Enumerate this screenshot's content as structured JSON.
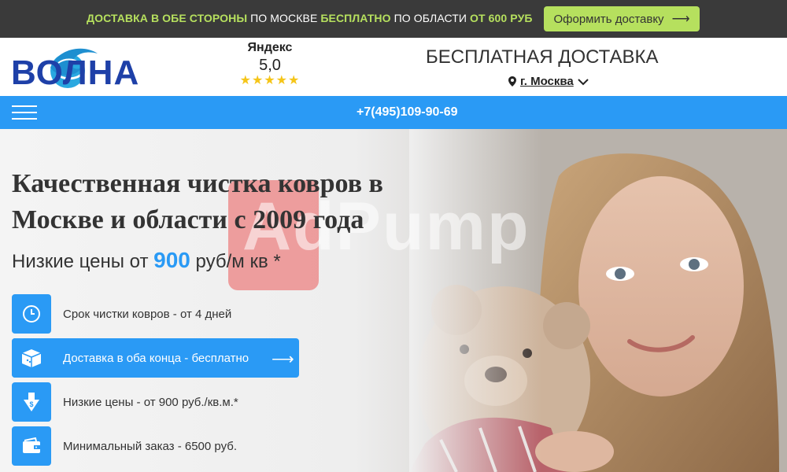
{
  "promo": {
    "part1": "ДОСТАВКА В ОБЕ СТОРОНЫ",
    "part2": " ПО МОСКВЕ ",
    "part3": "БЕСПЛАТНО",
    "part4": " ПО ОБЛАСТИ ",
    "part5": "ОТ 600 РУБ",
    "button_label": "Оформить доставку"
  },
  "header": {
    "logo": "ВОЛНА",
    "rating_source": "Яндекс",
    "rating_value": "5,0",
    "stars": "★★★★★",
    "free_delivery": "БЕСПЛАТНАЯ ДОСТАВКА",
    "city": "г. Москва"
  },
  "nav": {
    "phone": "+7(495)109-90-69"
  },
  "hero": {
    "title": "Качественная чистка ковров в Москве и области с 2009 года",
    "price_prefix": "Низкие цены от ",
    "price_value": "900",
    "price_suffix": " руб/м кв *",
    "watermark": "AdPump"
  },
  "features": [
    {
      "label": "Срок чистки ковров - от 4 дней",
      "icon": "clock-icon"
    },
    {
      "label": "Доставка в оба конца - бесплатно",
      "icon": "box-icon"
    },
    {
      "label": "Низкие цены - от 900 руб./кв.м.*",
      "icon": "price-down-icon"
    },
    {
      "label": "Минимальный заказ - 6500 руб.",
      "icon": "wallet-icon"
    }
  ],
  "colors": {
    "accent": "#2a9af5",
    "promo_bg": "#3a3a3a",
    "promo_highlight": "#b6e05e",
    "logo": "#1e40a8"
  }
}
